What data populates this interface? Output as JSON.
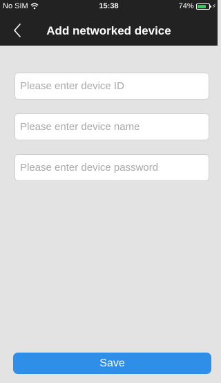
{
  "status_bar": {
    "carrier": "No SIM",
    "time": "15:38",
    "battery_text": "74%",
    "battery_level": 0.74,
    "battery_color": "#35c759",
    "icons": [
      "wifi-icon",
      "battery-icon",
      "charging-icon"
    ]
  },
  "nav": {
    "back_icon": "chevron-left-icon",
    "title": "Add networked device",
    "background": "#222222"
  },
  "form": {
    "device_id": {
      "placeholder": "Please enter device ID",
      "value": ""
    },
    "device_name": {
      "placeholder": "Please enter device name",
      "value": ""
    },
    "device_password": {
      "placeholder": "Please enter device password",
      "value": ""
    }
  },
  "actions": {
    "save_label": "Save",
    "save_color": "#2f8ee8"
  }
}
